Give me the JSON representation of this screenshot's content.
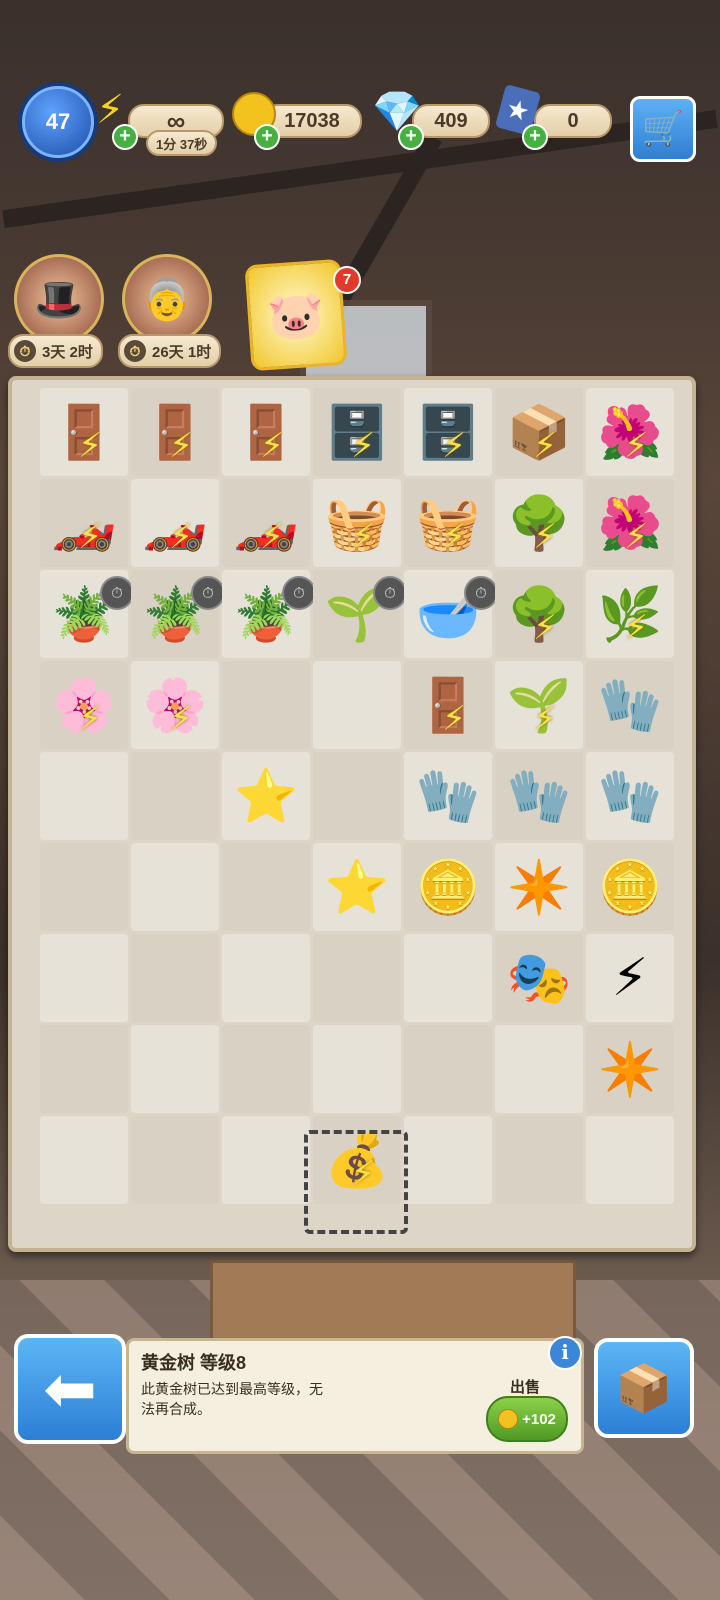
{
  "hud": {
    "level": "47",
    "energy_value": "∞",
    "energy_timer": "1分 37秒",
    "coins": "17038",
    "gems": "409",
    "cards": "0"
  },
  "characters": [
    {
      "name_icon": "magician-character",
      "timer": "3天 2时"
    },
    {
      "name_icon": "grandma-character",
      "timer": "26天 1时"
    }
  ],
  "reward": {
    "icon": "piggy-bank-icon",
    "badge": "7"
  },
  "board": {
    "items": [
      {
        "r": 0,
        "c": 0,
        "emoji": "🚪",
        "bolt": true,
        "name": "wardrobe-item"
      },
      {
        "r": 0,
        "c": 1,
        "emoji": "🚪",
        "bolt": true,
        "name": "wardrobe-item"
      },
      {
        "r": 0,
        "c": 2,
        "emoji": "🚪",
        "bolt": true,
        "name": "wardrobe-item"
      },
      {
        "r": 0,
        "c": 3,
        "emoji": "🗄️",
        "bolt": true,
        "name": "dresser-item"
      },
      {
        "r": 0,
        "c": 4,
        "emoji": "🗄️",
        "bolt": true,
        "name": "dresser-item"
      },
      {
        "r": 0,
        "c": 5,
        "emoji": "📦",
        "bolt": true,
        "name": "boxes-item"
      },
      {
        "r": 0,
        "c": 6,
        "emoji": "🌺",
        "bolt": true,
        "name": "flower-bush-item"
      },
      {
        "r": 1,
        "c": 0,
        "emoji": "🏎️",
        "bolt": true,
        "name": "toy-car-item"
      },
      {
        "r": 1,
        "c": 1,
        "emoji": "🏎️",
        "bolt": true,
        "name": "toy-car-item"
      },
      {
        "r": 1,
        "c": 2,
        "emoji": "🏎️",
        "bolt": true,
        "name": "toy-car-item"
      },
      {
        "r": 1,
        "c": 3,
        "emoji": "🧺",
        "bolt": true,
        "name": "tool-bucket-item"
      },
      {
        "r": 1,
        "c": 4,
        "emoji": "🧺",
        "bolt": true,
        "name": "tool-bucket-item"
      },
      {
        "r": 1,
        "c": 5,
        "emoji": "🌳",
        "bolt": true,
        "name": "tree-item"
      },
      {
        "r": 1,
        "c": 6,
        "emoji": "🌺",
        "bolt": true,
        "name": "flower-bush-item"
      },
      {
        "r": 2,
        "c": 0,
        "emoji": "🪴",
        "stop": true,
        "name": "potted-sprout-item"
      },
      {
        "r": 2,
        "c": 1,
        "emoji": "🪴",
        "stop": true,
        "name": "potted-sprout-item"
      },
      {
        "r": 2,
        "c": 2,
        "emoji": "🪴",
        "stop": true,
        "name": "potted-sprout-item"
      },
      {
        "r": 2,
        "c": 3,
        "emoji": "🌱",
        "stop": true,
        "name": "potted-sprout-item"
      },
      {
        "r": 2,
        "c": 4,
        "emoji": "🥣",
        "stop": true,
        "name": "empty-pot-item"
      },
      {
        "r": 2,
        "c": 5,
        "emoji": "🌳",
        "bolt": true,
        "name": "tree-item"
      },
      {
        "r": 2,
        "c": 6,
        "emoji": "🌿",
        "bolt": true,
        "name": "plant-item"
      },
      {
        "r": 3,
        "c": 0,
        "emoji": "🌸",
        "bolt": true,
        "name": "flower-pot-item"
      },
      {
        "r": 3,
        "c": 1,
        "emoji": "🌸",
        "bolt": true,
        "name": "flower-pot-item"
      },
      {
        "r": 3,
        "c": 4,
        "emoji": "🚪",
        "bolt": true,
        "name": "wardrobe-item"
      },
      {
        "r": 3,
        "c": 5,
        "emoji": "🌱",
        "bolt": true,
        "name": "sapling-item"
      },
      {
        "r": 3,
        "c": 6,
        "emoji": "🧤",
        "name": "gloves-item"
      },
      {
        "r": 4,
        "c": 2,
        "emoji": "⭐",
        "name": "blue-star-item"
      },
      {
        "r": 4,
        "c": 4,
        "emoji": "🧤",
        "name": "gloves-item"
      },
      {
        "r": 4,
        "c": 5,
        "emoji": "🧤",
        "name": "gloves-item"
      },
      {
        "r": 4,
        "c": 6,
        "emoji": "🧤",
        "name": "gloves-item"
      },
      {
        "r": 5,
        "c": 3,
        "emoji": "⭐",
        "name": "blue-star-item"
      },
      {
        "r": 5,
        "c": 4,
        "emoji": "🪙",
        "name": "coins-item"
      },
      {
        "r": 5,
        "c": 5,
        "emoji": "✴️",
        "name": "blue-star-burst-item"
      },
      {
        "r": 5,
        "c": 6,
        "emoji": "🪙",
        "name": "coin-pile-item"
      },
      {
        "r": 6,
        "c": 5,
        "emoji": "🎭",
        "name": "mask-item"
      },
      {
        "r": 6,
        "c": 6,
        "emoji": "⚡",
        "name": "energy-bubble-item"
      },
      {
        "r": 7,
        "c": 6,
        "emoji": "✴️",
        "name": "blue-star-burst-item"
      },
      {
        "r": 8,
        "c": 3,
        "emoji": "💰",
        "bolt": true,
        "name": "golden-tree-sack-item"
      }
    ]
  },
  "info": {
    "title": "黄金树 等级8",
    "text": "此黄金树已达到最高等级，无法再合成。",
    "sell_label": "出售",
    "sell_value": "+102"
  }
}
